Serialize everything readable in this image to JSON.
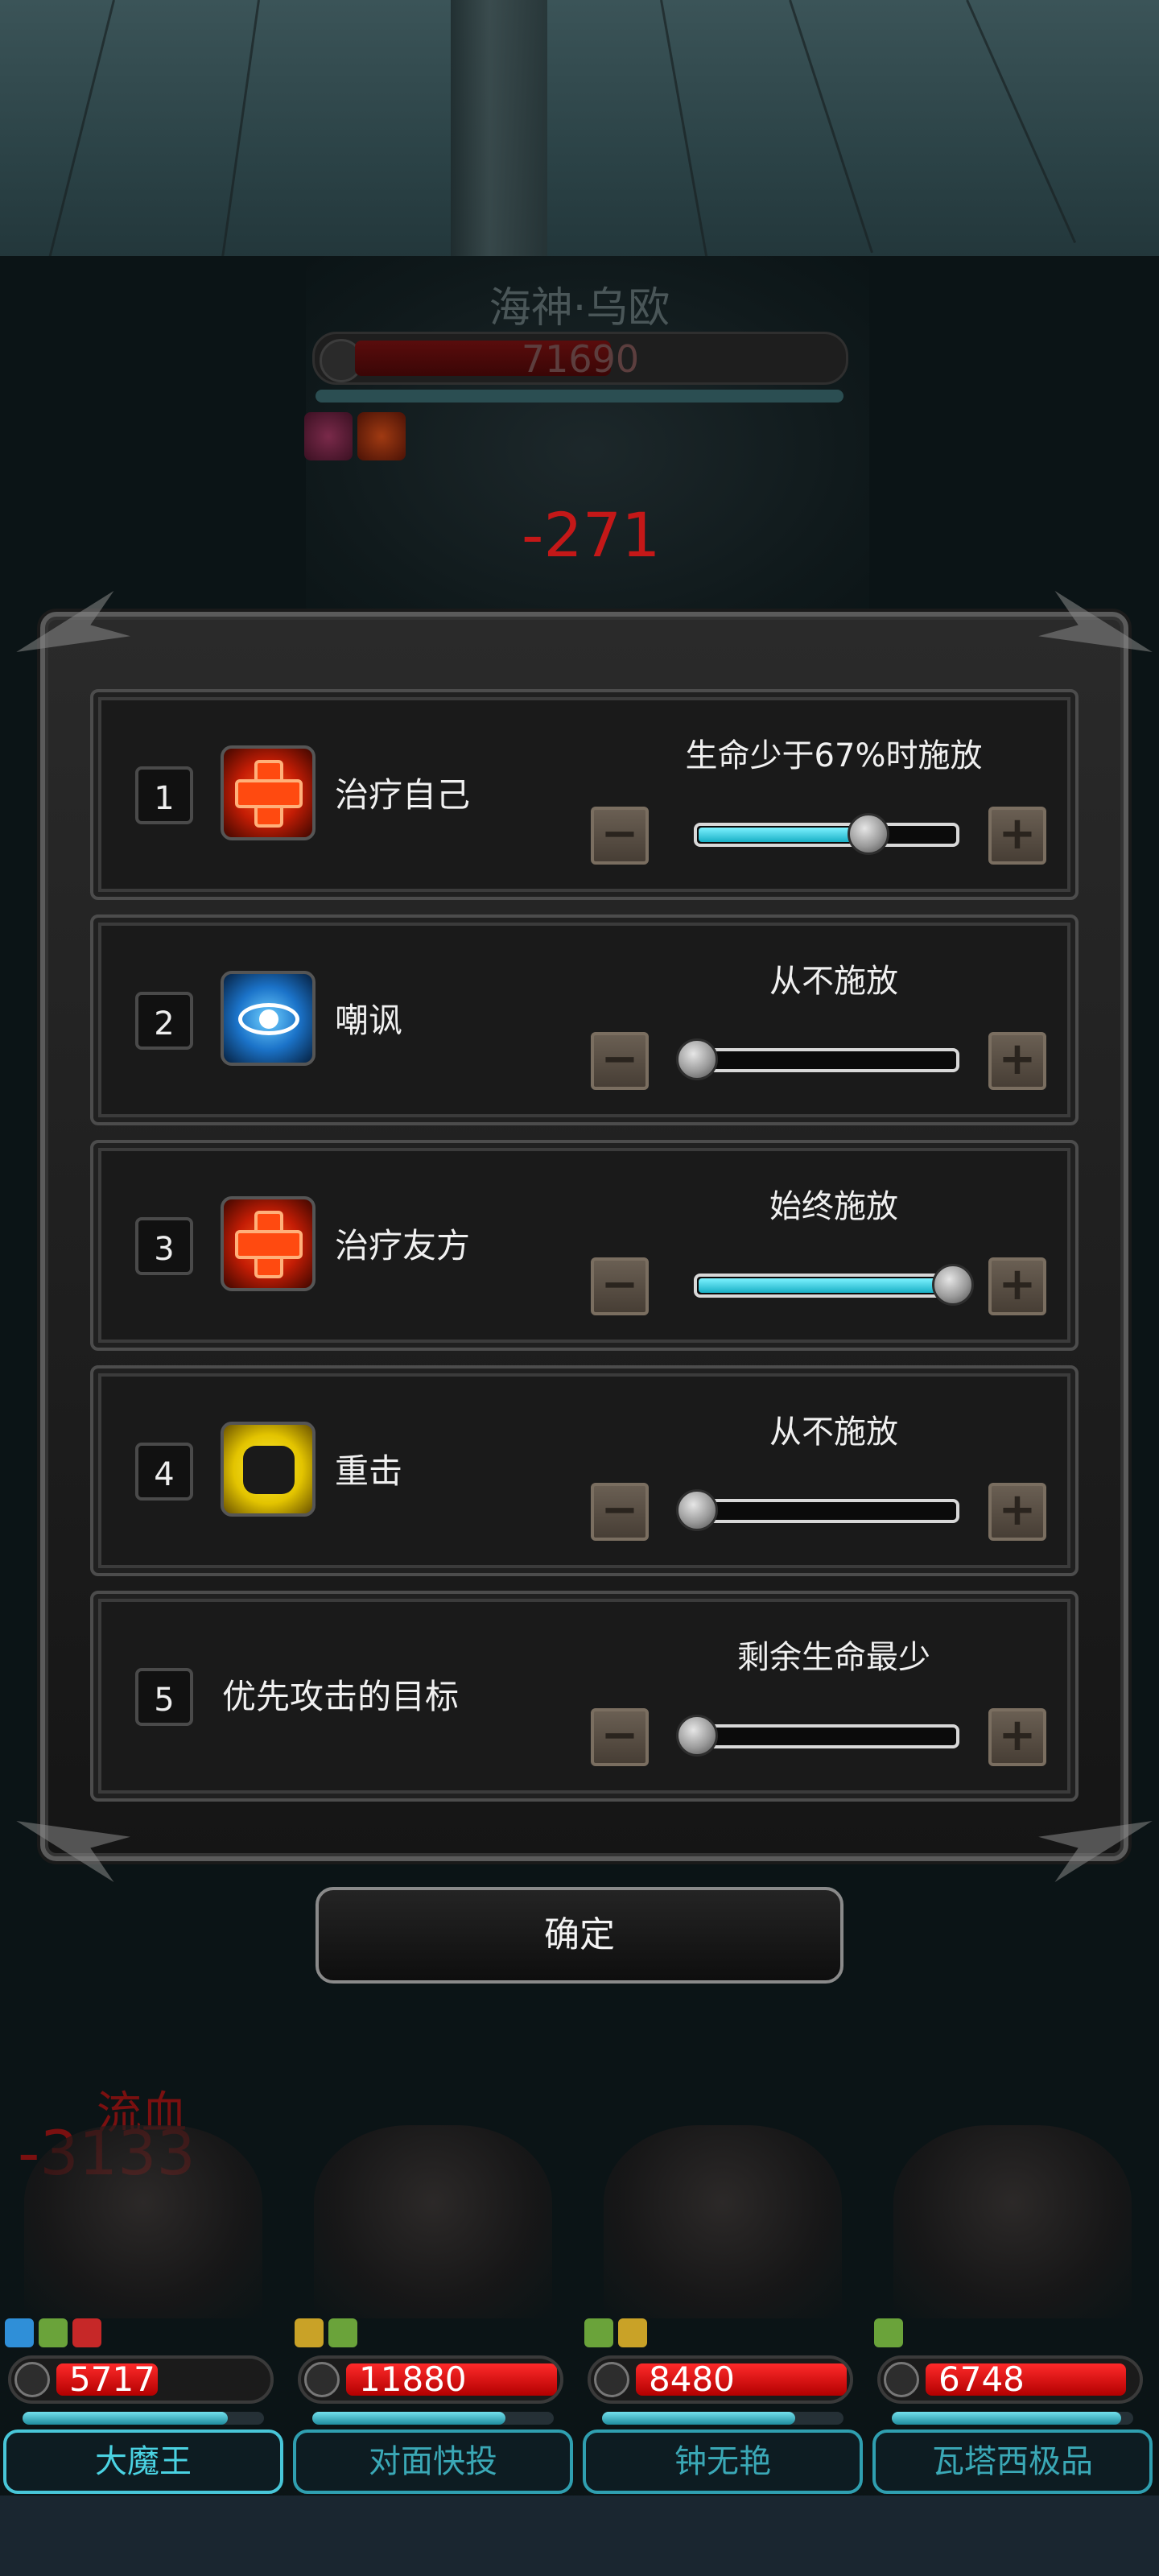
{
  "boss": {
    "name": "海神·乌欧",
    "hp_text": "71690",
    "hp_fraction": 0.53,
    "mp_fraction": 1.0
  },
  "floating": {
    "boss_damage": "-271",
    "bleed_label": "流血",
    "bleed_damage": "-3133"
  },
  "rules": [
    {
      "index": "1",
      "icon": "heal-icon",
      "name": "治疗自己",
      "condition": "生命少于67%时施放",
      "level": 0.67
    },
    {
      "index": "2",
      "icon": "eye-icon",
      "name": "嘲讽",
      "condition": "从不施放",
      "level": 0.0
    },
    {
      "index": "3",
      "icon": "heal-icon",
      "name": "治疗友方",
      "condition": "始终施放",
      "level": 1.0
    },
    {
      "index": "4",
      "icon": "fist-icon",
      "name": "重击",
      "condition": "从不施放",
      "level": 0.0
    },
    {
      "index": "5",
      "icon": "",
      "name": "优先攻击的目标",
      "condition": "剩余生命最少",
      "level": 0.0
    }
  ],
  "controls": {
    "minus": "−",
    "plus": "+"
  },
  "confirm_label": "确定",
  "party": [
    {
      "name": "大魔王",
      "hp": "5717",
      "hp_fraction": 0.48,
      "mp_fraction": 0.85,
      "active": true,
      "buff_colors": [
        "#2f8fd8",
        "#6aa33a",
        "#c62828"
      ]
    },
    {
      "name": "对面快投",
      "hp": "11880",
      "hp_fraction": 1.0,
      "mp_fraction": 0.8,
      "active": false,
      "buff_colors": [
        "#c9a227",
        "#6aa33a"
      ]
    },
    {
      "name": "钟无艳",
      "hp": "8480",
      "hp_fraction": 1.0,
      "mp_fraction": 0.8,
      "active": false,
      "buff_colors": [
        "#6aa33a",
        "#c9a227"
      ]
    },
    {
      "name": "瓦塔西极品",
      "hp": "6748",
      "hp_fraction": 0.95,
      "mp_fraction": 0.95,
      "active": false,
      "buff_colors": [
        "#6aa33a"
      ]
    }
  ],
  "colors": {
    "accent_cyan": "#19b0c6",
    "hp_red": "#d01010",
    "damage_red": "#c41818"
  }
}
